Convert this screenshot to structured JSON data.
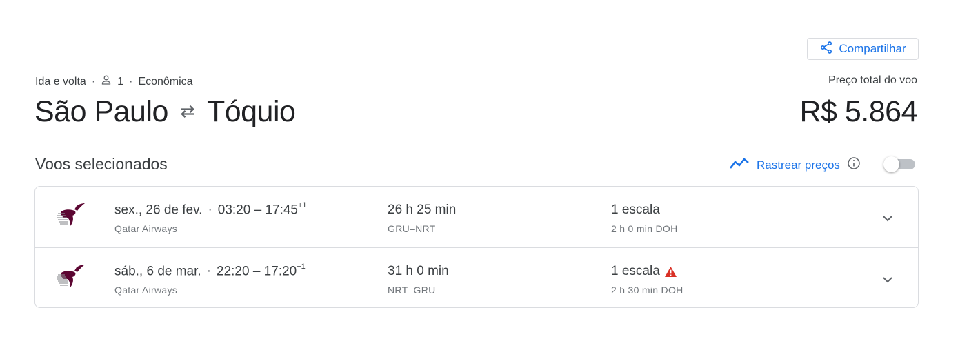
{
  "share": {
    "label": "Compartilhar"
  },
  "trip": {
    "type": "Ida e volta",
    "passengers": "1",
    "cabin": "Econômica",
    "origin": "São Paulo",
    "destination": "Tóquio"
  },
  "price": {
    "label": "Preço total do voo",
    "value": "R$ 5.864"
  },
  "section": {
    "title": "Voos selecionados"
  },
  "track": {
    "label": "Rastrear preços",
    "enabled": false
  },
  "colors": {
    "accent": "#1a73e8",
    "warning": "#d93025",
    "airline": "#5c0632"
  },
  "flights": [
    {
      "date": "sex., 26 de fev.",
      "times": "03:20 – 17:45",
      "day_offset": "+1",
      "airline": "Qatar Airways",
      "duration": "26 h 25 min",
      "airports": "GRU–NRT",
      "stops": "1 escala",
      "layover": "2 h 0 min DOH",
      "warning": false
    },
    {
      "date": "sáb., 6 de mar.",
      "times": "22:20 – 17:20",
      "day_offset": "+1",
      "airline": "Qatar Airways",
      "duration": "31 h 0 min",
      "airports": "NRT–GRU",
      "stops": "1 escala",
      "layover": "2 h 30 min DOH",
      "warning": true
    }
  ]
}
